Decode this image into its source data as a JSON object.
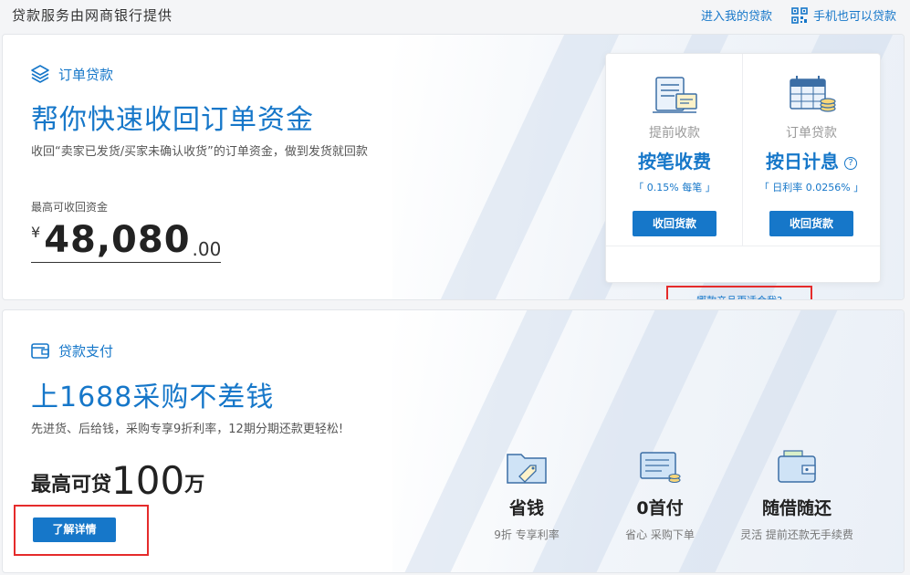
{
  "topbar": {
    "provider": "贷款服务由网商银行提供",
    "my_loan_link": "进入我的贷款",
    "mobile_link": "手机也可以贷款",
    "mobile_icon": "qr-code-icon"
  },
  "order_loan": {
    "tag": "订单贷款",
    "tag_icon": "layers-icon",
    "headline": "帮你快速收回订单资金",
    "subline": "收回“卖家已发货/买家未确认收货”的订单资金，做到发货就回款",
    "max_label": "最高可收回资金",
    "currency": "¥",
    "amount_int": "48,080",
    "amount_dec": ".00",
    "products": [
      {
        "category": "提前收款",
        "title": "按笔收费",
        "rate": "「 0.15% 每笔 」",
        "button": "收回货款",
        "icon": "document-pen-icon"
      },
      {
        "category": "订单贷款",
        "title": "按日计息",
        "rate": "「 日利率 0.0256% 」",
        "button": "收回货款",
        "icon": "calendar-coins-icon",
        "help": "?"
      }
    ],
    "which_link": "哪款产品更适合我?"
  },
  "purchase_loan": {
    "tag": "贷款支付",
    "tag_icon": "wallet-icon",
    "headline": "上1688采购不差钱",
    "subline": "先进货、后给钱，采购专享9折利率，12期分期还款更轻松!",
    "max_prefix": "最高可贷",
    "max_number": "100",
    "max_unit": "万",
    "detail_button": "了解详情",
    "features": [
      {
        "title": "省钱",
        "desc": "9折 专享利率",
        "icon": "discount-tag-icon"
      },
      {
        "title": "0首付",
        "desc": "省心 采购下单",
        "icon": "card-coins-icon"
      },
      {
        "title": "随借随还",
        "desc": "灵活 提前还款无手续费",
        "icon": "wallet-cash-icon"
      }
    ]
  },
  "colors": {
    "accent": "#1677c9",
    "highlight_frame": "#e52b2b"
  }
}
